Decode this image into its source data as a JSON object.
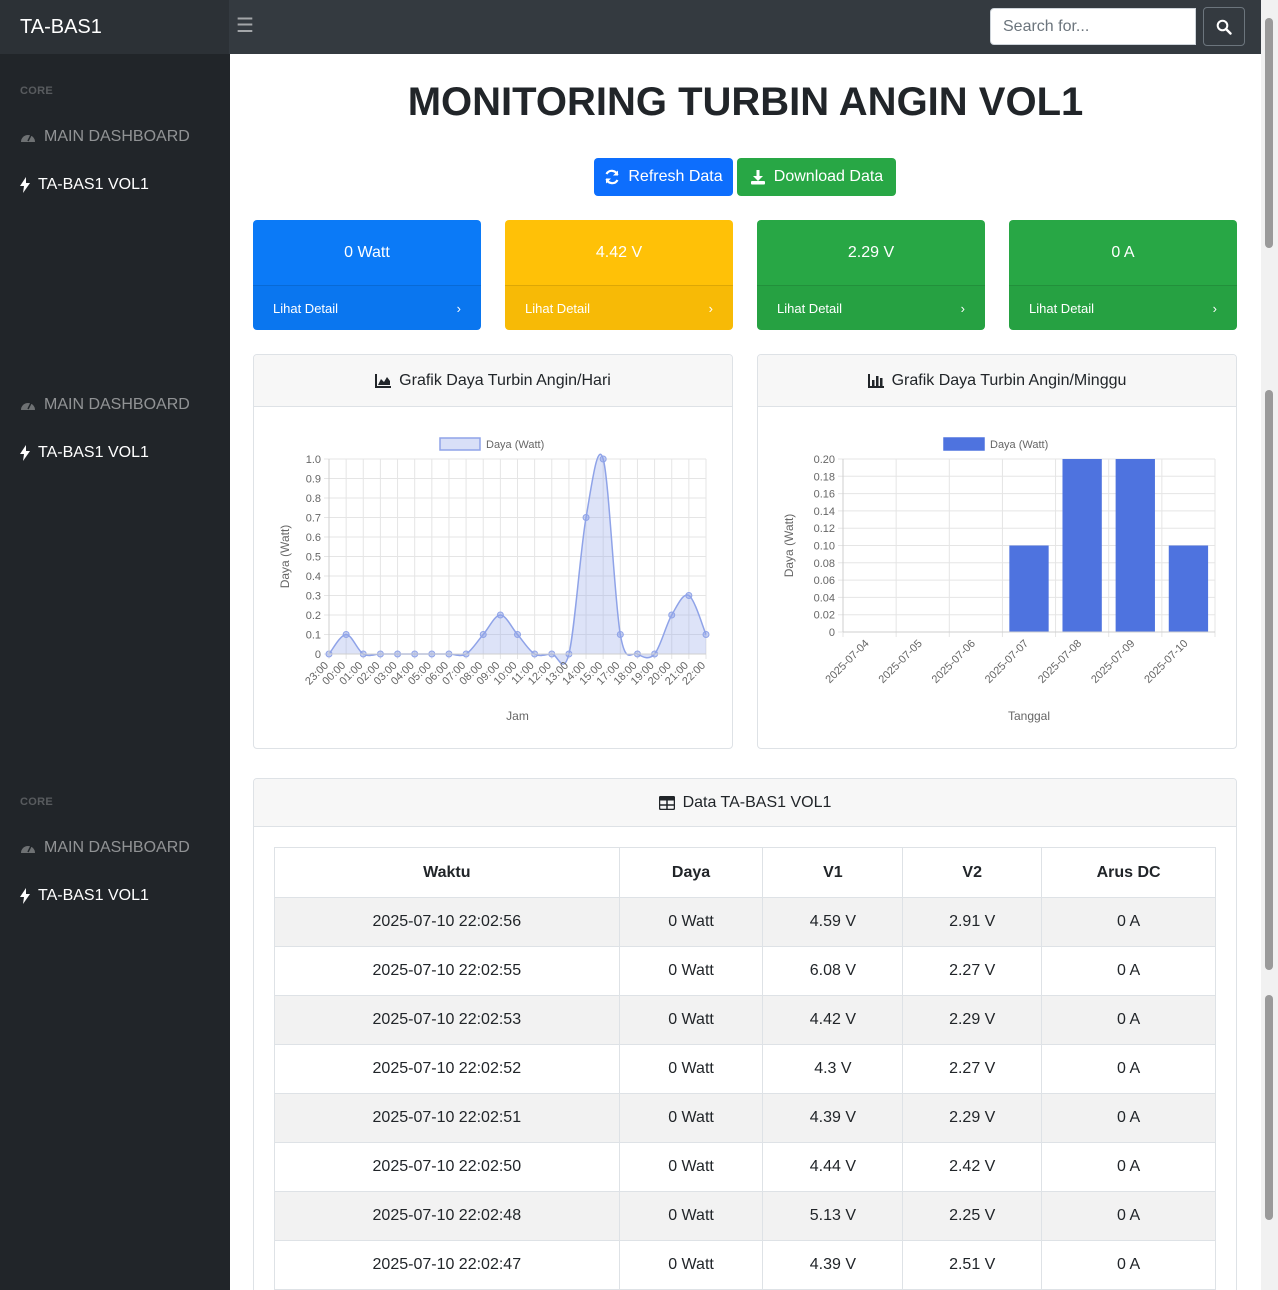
{
  "app": {
    "brand": "TA-BAS1",
    "search_placeholder": "Search for..."
  },
  "sidebar": {
    "sections": [
      {
        "heading": "CORE",
        "links": [
          {
            "label": "MAIN DASHBOARD",
            "active": false
          },
          {
            "label": "TA-BAS1 VOL1",
            "active": true
          }
        ]
      },
      {
        "heading": "",
        "links": [
          {
            "label": "MAIN DASHBOARD",
            "active": false
          },
          {
            "label": "TA-BAS1 VOL1",
            "active": true
          }
        ]
      },
      {
        "heading": "CORE",
        "links": [
          {
            "label": "MAIN DASHBOARD",
            "active": false
          },
          {
            "label": "TA-BAS1 VOL1",
            "active": true
          }
        ]
      }
    ]
  },
  "main": {
    "title": "MONITORING TURBIN ANGIN VOL1",
    "refresh_label": "Refresh Data",
    "download_label": "Download Data",
    "cards": [
      {
        "value": "0 Watt",
        "footer": "Lihat Detail",
        "color": "#0b7af7"
      },
      {
        "value": "4.42 V",
        "footer": "Lihat Detail",
        "color": "#ffc107"
      },
      {
        "value": "2.29 V",
        "footer": "Lihat Detail",
        "color": "#28a745"
      },
      {
        "value": "0 A",
        "footer": "Lihat Detail",
        "color": "#28a745"
      }
    ],
    "daily_chart_title": "Grafik Daya Turbin Angin/Hari",
    "weekly_chart_title": "Grafik Daya Turbin Angin/Minggu",
    "table_title": "Data TA-BAS1 VOL1",
    "table": {
      "headers": [
        "Waktu",
        "Daya",
        "V1",
        "V2",
        "Arus DC"
      ],
      "rows": [
        [
          "2025-07-10 22:02:56",
          "0 Watt",
          "4.59 V",
          "2.91 V",
          "0 A"
        ],
        [
          "2025-07-10 22:02:55",
          "0 Watt",
          "6.08 V",
          "2.27 V",
          "0 A"
        ],
        [
          "2025-07-10 22:02:53",
          "0 Watt",
          "4.42 V",
          "2.29 V",
          "0 A"
        ],
        [
          "2025-07-10 22:02:52",
          "0 Watt",
          "4.3 V",
          "2.27 V",
          "0 A"
        ],
        [
          "2025-07-10 22:02:51",
          "0 Watt",
          "4.39 V",
          "2.29 V",
          "0 A"
        ],
        [
          "2025-07-10 22:02:50",
          "0 Watt",
          "4.44 V",
          "2.42 V",
          "0 A"
        ],
        [
          "2025-07-10 22:02:48",
          "0 Watt",
          "5.13 V",
          "2.25 V",
          "0 A"
        ],
        [
          "2025-07-10 22:02:47",
          "0 Watt",
          "4.39 V",
          "2.51 V",
          "0 A"
        ]
      ]
    }
  },
  "chart_data": [
    {
      "type": "area",
      "title": "Grafik Daya Turbin Angin/Hari",
      "xlabel": "Jam",
      "ylabel": "Daya (Watt)",
      "ylim": [
        0,
        1.0
      ],
      "grid": true,
      "legend_position": "top",
      "color": "#8fa3e8",
      "categories": [
        "23:00",
        "00:00",
        "01:00",
        "02:00",
        "03:00",
        "04:00",
        "05:00",
        "06:00",
        "07:00",
        "08:00",
        "09:00",
        "10:00",
        "11:00",
        "12:00",
        "13:00",
        "14:00",
        "15:00",
        "17:00",
        "18:00",
        "19:00",
        "20:00",
        "21:00",
        "22:00"
      ],
      "series": [
        {
          "name": "Daya (Watt)",
          "values": [
            0,
            0.1,
            0,
            0,
            0,
            0,
            0,
            0,
            0,
            0.1,
            0.2,
            0.1,
            0,
            0,
            0,
            0.7,
            1.0,
            0.1,
            0,
            0,
            0.2,
            0.3,
            0.1
          ]
        }
      ],
      "y_ticks": [
        "0",
        "0.1",
        "0.2",
        "0.3",
        "0.4",
        "0.5",
        "0.6",
        "0.7",
        "0.8",
        "0.9",
        "1.0"
      ]
    },
    {
      "type": "bar",
      "title": "Grafik Daya Turbin Angin/Minggu",
      "xlabel": "Tanggal",
      "ylabel": "Daya (Watt)",
      "ylim": [
        0,
        0.2
      ],
      "grid": true,
      "legend_position": "top",
      "color": "#4e73df",
      "categories": [
        "2025-07-04",
        "2025-07-05",
        "2025-07-06",
        "2025-07-07",
        "2025-07-08",
        "2025-07-09",
        "2025-07-10"
      ],
      "series": [
        {
          "name": "Daya (Watt)",
          "values": [
            0,
            0,
            0,
            0.1,
            0.2,
            0.2,
            0.1
          ]
        }
      ],
      "y_ticks": [
        "0",
        "0.02",
        "0.04",
        "0.06",
        "0.08",
        "0.10",
        "0.12",
        "0.14",
        "0.16",
        "0.18",
        "0.20"
      ]
    }
  ]
}
